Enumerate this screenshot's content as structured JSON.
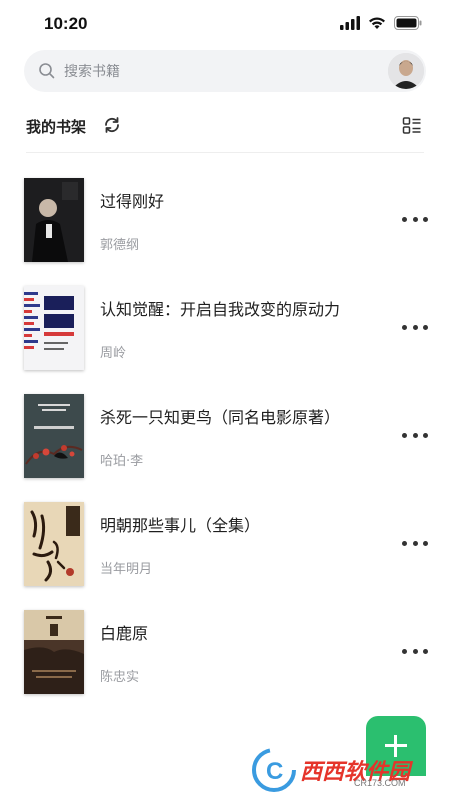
{
  "status_bar": {
    "time": "10:20"
  },
  "search": {
    "placeholder": "搜索书籍"
  },
  "shelf": {
    "title": "我的书架"
  },
  "books": [
    {
      "title": "过得刚好",
      "author": "郭德纲",
      "cover_color": "#1d1d1f"
    },
    {
      "title": "认知觉醒：开启自我改变的原动力",
      "author": "周岭",
      "cover_color": "#f4f4f6"
    },
    {
      "title": "杀死一只知更鸟（同名电影原著）",
      "author": "哈珀·李",
      "cover_color": "#3d4a4c"
    },
    {
      "title": "明朝那些事儿（全集）",
      "author": "当年明月",
      "cover_color": "#e8d7b7"
    },
    {
      "title": "白鹿原",
      "author": "陈忠实",
      "cover_color": "#4a3528"
    }
  ],
  "fab": {
    "icon": "plus-icon",
    "color": "#2bbf6f"
  },
  "watermark": {
    "brand": "西西软件园",
    "domain": "CR173.COM"
  }
}
